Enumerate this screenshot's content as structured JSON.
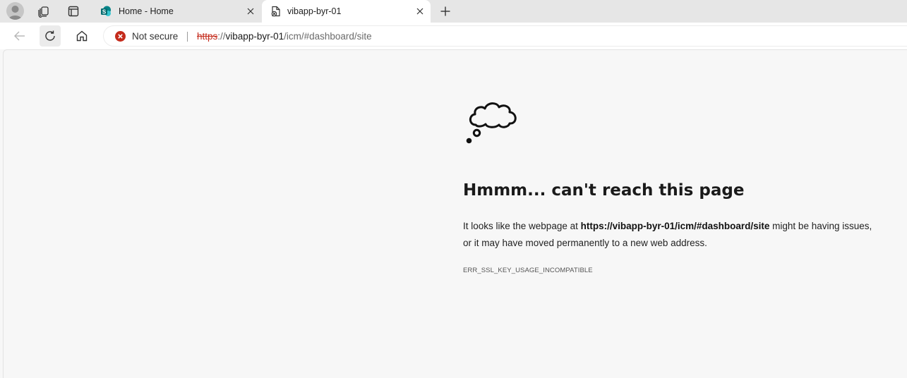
{
  "tabs": [
    {
      "title": "Home - Home",
      "active": false,
      "favicon": "sharepoint-icon"
    },
    {
      "title": "vibapp-byr-01",
      "active": true,
      "favicon": "broken-page-icon"
    }
  ],
  "toolbar": {
    "security_label": "Not secure",
    "url": {
      "scheme": "https",
      "separator": "://",
      "host": "vibapp-byr-01",
      "path": "/icm/#dashboard/site"
    }
  },
  "error": {
    "title": "Hmmm... can't reach this page",
    "desc_prefix": "It looks like the webpage at ",
    "desc_url": "https://vibapp-byr-01/icm/#dashboard/site",
    "desc_suffix": " might be having issues, or it may have moved permanently to a new web address.",
    "code": "ERR_SSL_KEY_USAGE_INCOMPATIBLE"
  },
  "colors": {
    "insecure_red": "#c42b1c",
    "sharepoint_teal": "#038387"
  }
}
